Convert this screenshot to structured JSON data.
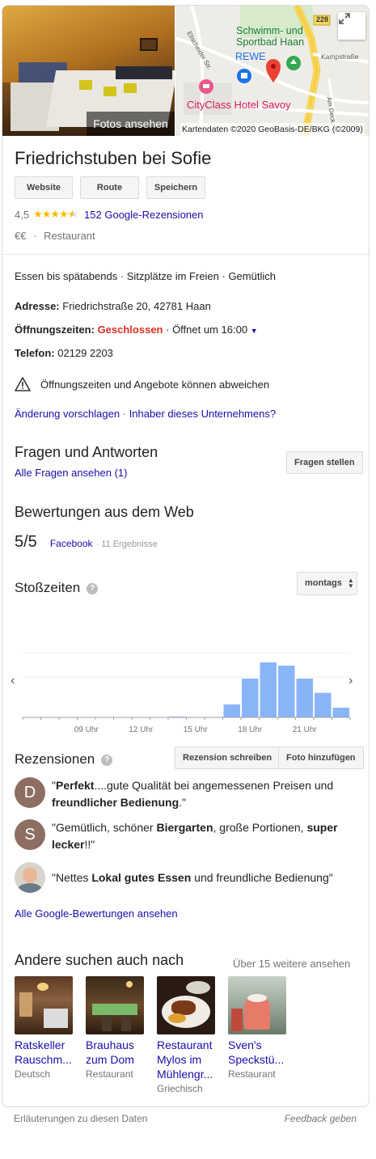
{
  "hero": {
    "photos_label": "Fotos ansehen",
    "map": {
      "labels": {
        "pool": "Schwimm- und\nSportbad Haan",
        "pool_line1": "Schwimm- und",
        "pool_line2": "Sportbad Haan",
        "rewe": "REWE",
        "hotel": "CityClass Hotel Savoy",
        "street1": "Ellscheider Str.",
        "street2": "Kampstraße",
        "street3": "Am Deck",
        "road_number": "228"
      },
      "credit": "Kartendaten ©2020 GeoBasis-DE/BKG (©2009)",
      "expand_icon": "expand-icon"
    }
  },
  "place": {
    "name": "Friedrichstuben bei Sofie",
    "buttons": [
      "Website",
      "Route",
      "Speichern"
    ],
    "rating_value": "4,5",
    "rating_stars": 4.5,
    "reviews_link": "152 Google-Rezensionen",
    "price": "€€",
    "separator": "·",
    "category": "Restaurant"
  },
  "details": {
    "highlights": "Essen bis spätabends · Sitzplätze im Freien · Gemütlich",
    "address_label": "Adresse:",
    "address_value": "Friedrichstraße 20, 42781 Haan",
    "hours_label": "Öffnungszeiten:",
    "hours_status": "Geschlossen",
    "hours_next": "· Öffnet um 16:00",
    "phone_label": "Telefon:",
    "phone_value": "02129 2203",
    "warning": "Öffnungszeiten und Angebote können abweichen",
    "suggest_edit": "Änderung vorschlagen",
    "link_sep": "·",
    "owner": "Inhaber dieses Unternehmens?"
  },
  "qa": {
    "title": "Fragen und Antworten",
    "link": "Alle Fragen ansehen (1)",
    "button": "Fragen stellen"
  },
  "web_reviews": {
    "title": "Bewertungen aus dem Web",
    "score": "5/5",
    "source": "Facebook",
    "count": "· 11 Ergebnisse"
  },
  "popular_times": {
    "title": "Stoßzeiten",
    "day_selector": "montags",
    "tick_labels": [
      "09 Uhr",
      "12 Uhr",
      "15 Uhr",
      "18 Uhr",
      "21 Uhr"
    ]
  },
  "chart_data": {
    "type": "bar",
    "categories": [
      "06",
      "07",
      "08",
      "09",
      "10",
      "11",
      "12",
      "13",
      "14",
      "15",
      "16",
      "17",
      "18",
      "19",
      "20",
      "21",
      "22",
      "23"
    ],
    "values": [
      0,
      0,
      0,
      0,
      0,
      0,
      0,
      0,
      1,
      0,
      0,
      20,
      60,
      85,
      80,
      60,
      38,
      15
    ],
    "ylim": [
      0,
      100
    ],
    "tick_labels": [
      "09 Uhr",
      "12 Uhr",
      "15 Uhr",
      "18 Uhr",
      "21 Uhr"
    ],
    "color": "#8ab4f8",
    "grid": true
  },
  "reviews": {
    "title": "Rezensionen",
    "write_button": "Rezension schreiben",
    "photo_button": "Foto hinzufügen",
    "items": [
      {
        "initial": "D",
        "color": "#8d6e63",
        "parts": [
          "\"",
          "Perfekt",
          "....gute Qualität bei angemessenen Preisen und ",
          "freundlicher Bedienung",
          ".\""
        ]
      },
      {
        "initial": "S",
        "color": "#8d6e63",
        "parts": [
          "\"Gemütlich, schöner ",
          "Biergarten",
          ", große Portionen, ",
          "super lecker",
          "!!\""
        ]
      },
      {
        "initial": "",
        "color": "#cfcfcf",
        "parts": [
          "\"Nettes ",
          "Lokal gutes Essen",
          " und freundliche Bedienung\""
        ]
      }
    ],
    "all_link": "Alle Google-Bewertungen ansehen"
  },
  "others": {
    "title": "Andere suchen auch nach",
    "more_link": "Über 15 weitere ansehen",
    "items": [
      {
        "name": "Ratskeller Rauschm...",
        "category": "Deutsch"
      },
      {
        "name": "Brauhaus zum Dom",
        "category": "Restaurant"
      },
      {
        "name": "Restaurant Mylos im Mühlengr...",
        "category": "Griechisch"
      },
      {
        "name": "Sven's Speckstü...",
        "category": "Restaurant"
      }
    ]
  },
  "footer": {
    "left": "Erläuterungen zu diesen Daten",
    "right": "Feedback geben"
  }
}
